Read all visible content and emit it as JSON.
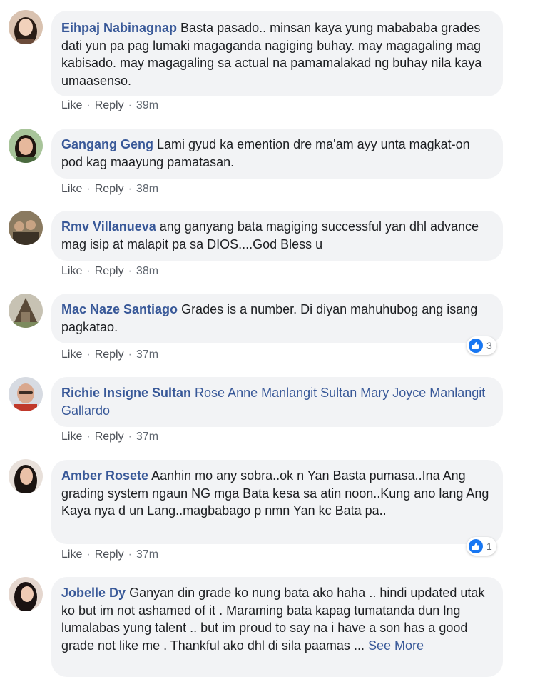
{
  "comments": [
    {
      "author": "Eihpaj Nabinagnap",
      "text": "Basta pasado.. minsan kaya yung mabababa grades dati yun pa pag lumaki magaganda nagiging buhay. may magagaling mag kabisado. may magagaling sa actual na pamamalakad ng buhay nila kaya umaasenso.",
      "like": "Like",
      "reply": "Reply",
      "time": "39m",
      "avatar_colors": {
        "bg": "#d9c2b0",
        "hair": "#2a1d16",
        "face": "#f1d1bb"
      }
    },
    {
      "author": "Gangang Geng",
      "text": "Lami gyud ka emention dre ma'am ayy unta magkat-on pod kag maayung pamatasan.",
      "like": "Like",
      "reply": "Reply",
      "time": "38m",
      "avatar_colors": {
        "bg": "#a8c49a",
        "hair": "#1f1510",
        "face": "#e6b89c"
      }
    },
    {
      "author": "Rmv Villanueva",
      "text": "ang ganyang bata magiging successful yan dhl advance mag isip at malapit pa sa DIOS....God Bless u",
      "like": "Like",
      "reply": "Reply",
      "time": "38m",
      "avatar_colors": {
        "bg": "#8a7a60",
        "hair": "#3b3226",
        "face": "#c8a383"
      }
    },
    {
      "author": "Mac Naze Santiago",
      "text": "Grades is a number. Di diyan mahuhubog ang isang pagkatao.",
      "like": "Like",
      "reply": "Reply",
      "time": "37m",
      "reaction_count": "3",
      "avatar_colors": {
        "bg": "#c7c2b3",
        "hair": "#5a4a38",
        "face": "#8c7a62"
      }
    },
    {
      "author": "Richie Insigne Sultan",
      "mentions": "Rose Anne Manlangit Sultan Mary Joyce Manlangit Gallardo",
      "like": "Like",
      "reply": "Reply",
      "time": "37m",
      "avatar_colors": {
        "bg": "#d7dbe2",
        "hair": "#3a2c24",
        "face": "#d9a88e"
      }
    },
    {
      "author": "Amber Rosete",
      "text": "Aanhin mo any sobra..ok n Yan Basta pumasa..Ina Ang grading system ngaun NG mga Bata kesa sa atin noon..Kung ano lang Ang Kaya nya d un Lang..magbabago p nmn Yan kc Bata pa..",
      "like": "Like",
      "reply": "Reply",
      "time": "37m",
      "reaction_count": "1",
      "avatar_colors": {
        "bg": "#e8e0da",
        "hair": "#1b1411",
        "face": "#eac1a8"
      }
    },
    {
      "author": "Jobelle Dy",
      "text": "Ganyan din grade ko nung bata ako haha .. hindi updated utak ko but im not ashamed of it . Maraming bata kapag tumatanda dun lng lumalabas yung talent .. but im proud to say na i have a son has a good grade not like me . Thankful ako dhl di sila",
      "text_cut": "paamas",
      "see_more": "See More",
      "avatar_colors": {
        "bg": "#e5d7cf",
        "hair": "#1a1212",
        "face": "#efcab4"
      }
    }
  ],
  "colors": {
    "author": "#385898",
    "bubble": "#f2f3f5",
    "like_blue": "#1877f2"
  }
}
